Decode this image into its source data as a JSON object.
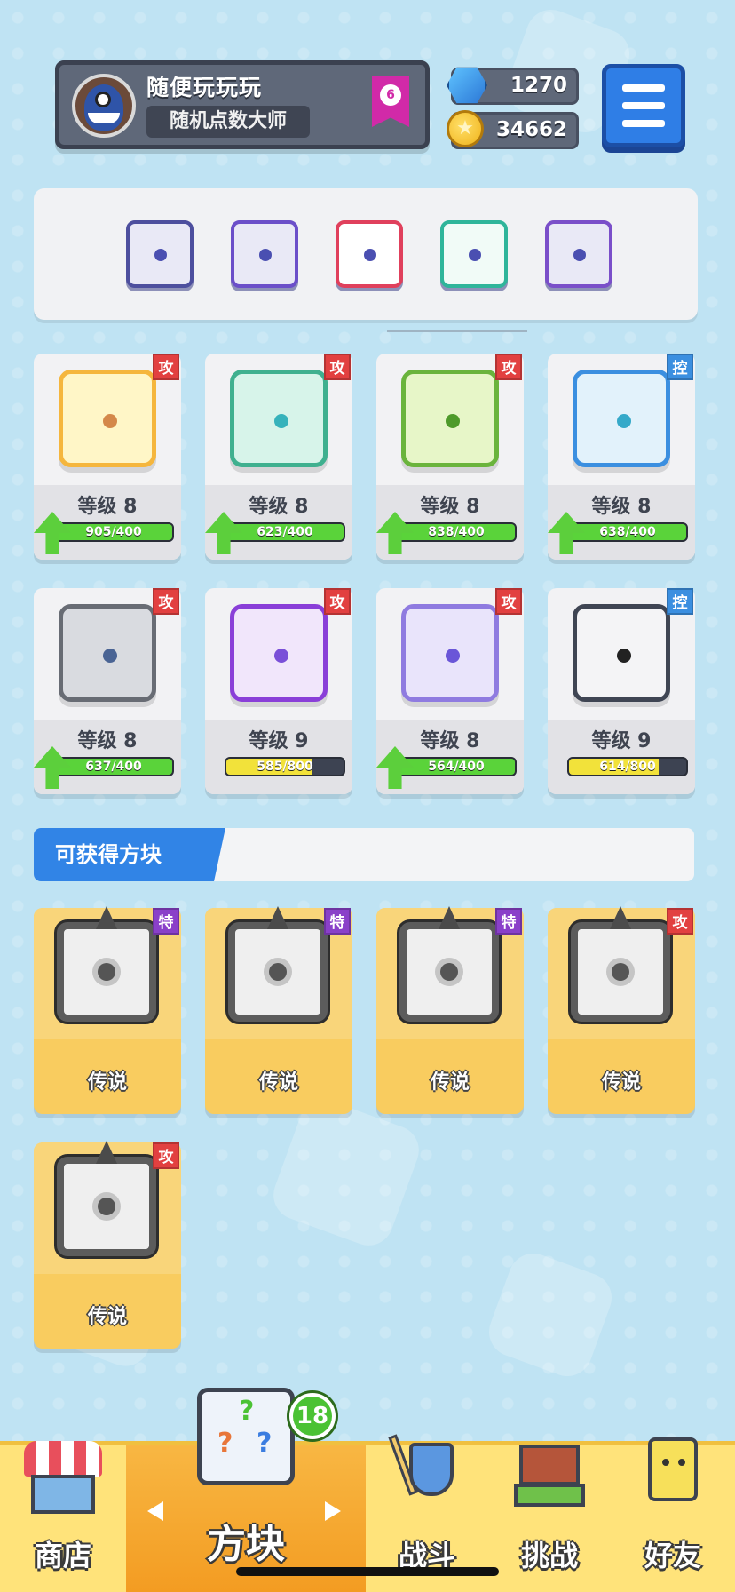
{
  "profile": {
    "name": "随便玩玩玩",
    "title": "随机点数大师",
    "rank": "6",
    "rank_color": "#d12aa8"
  },
  "currency": {
    "gems": "1270",
    "coins": "34662"
  },
  "deck": {
    "slots": [
      {
        "icon": "gear-dice-icon",
        "color": "#3f6bbf"
      },
      {
        "icon": "dragon-dice-icon",
        "color": "#6b4fc9"
      },
      {
        "icon": "rainbow-dice-icon",
        "color": "#e0405c"
      },
      {
        "icon": "heal-dice-icon",
        "color": "#2fb59a"
      },
      {
        "icon": "crack-dice-icon",
        "color": "#7a4fc9"
      }
    ]
  },
  "owned_dice": [
    {
      "icon": "fire-dice-icon",
      "tag": "攻",
      "tag_type": "atk",
      "level": "等级 8",
      "xp": "905/400",
      "upgradable": true,
      "color": "#f5b63d",
      "fill": "#fff6c7",
      "pip": "#d4884a"
    },
    {
      "icon": "wind-dice-icon",
      "tag": "攻",
      "tag_type": "atk",
      "level": "等级 8",
      "xp": "623/400",
      "upgradable": true,
      "color": "#3fb08f",
      "fill": "#d7f4ea",
      "pip": "#36b2bb"
    },
    {
      "icon": "poison-dice-icon",
      "tag": "攻",
      "tag_type": "atk",
      "level": "等级 8",
      "xp": "838/400",
      "upgradable": true,
      "color": "#6ab43c",
      "fill": "#e7f6c8",
      "pip": "#4e9a2a"
    },
    {
      "icon": "ice-dice-icon",
      "tag": "控",
      "tag_type": "ctl",
      "level": "等级 8",
      "xp": "638/400",
      "upgradable": true,
      "color": "#3b8fe0",
      "fill": "#e2f2fb",
      "pip": "#35a9c9"
    },
    {
      "icon": "gear-dice-icon",
      "tag": "攻",
      "tag_type": "atk",
      "level": "等级 8",
      "xp": "637/400",
      "upgradable": true,
      "color": "#686c74",
      "fill": "#d9dbe0",
      "pip": "#4a6494"
    },
    {
      "icon": "arrow-dice-icon",
      "tag": "攻",
      "tag_type": "atk",
      "level": "等级 9",
      "xp": "585/800",
      "upgradable": false,
      "color": "#8a3fd8",
      "fill": "#f1e6fb",
      "pip": "#7a4fd8"
    },
    {
      "icon": "mystery-dice-icon",
      "tag": "攻",
      "tag_type": "atk",
      "level": "等级 8",
      "xp": "564/400",
      "upgradable": true,
      "color": "#8f7be0",
      "fill": "#e9e4fb",
      "pip": "#6a56d8"
    },
    {
      "icon": "lock-dice-icon",
      "tag": "控",
      "tag_type": "ctl",
      "level": "等级 9",
      "xp": "614/800",
      "upgradable": false,
      "color": "#3f4553",
      "fill": "#f4f4f6",
      "pip": "#222"
    }
  ],
  "obtainable": {
    "label": "可获得方块",
    "items": [
      {
        "icon": "infinity-dice-icon",
        "tag": "特",
        "tag_type": "spc",
        "rarity": "传说"
      },
      {
        "icon": "sword-dice-icon",
        "tag": "特",
        "tag_type": "spc",
        "rarity": "传说"
      },
      {
        "icon": "flame-dice-icon",
        "tag": "特",
        "tag_type": "spc",
        "rarity": "传说"
      },
      {
        "icon": "star-dice-icon",
        "tag": "攻",
        "tag_type": "atk",
        "rarity": "传说"
      },
      {
        "icon": "vortex-dice-icon",
        "tag": "攻",
        "tag_type": "atk",
        "rarity": "传说"
      }
    ]
  },
  "nav": {
    "tabs": [
      {
        "label": "商店",
        "icon": "shop-icon"
      },
      {
        "label": "方块",
        "icon": "dice-icon",
        "badge": "18",
        "active": true
      },
      {
        "label": "战斗",
        "icon": "battle-icon"
      },
      {
        "label": "挑战",
        "icon": "challenge-icon"
      },
      {
        "label": "好友",
        "icon": "friend-icon"
      }
    ]
  },
  "colors": {
    "xp_full": "#5ad33a",
    "xp_partial": "#f2e23a",
    "menu_blue": "#2f7ee6"
  }
}
